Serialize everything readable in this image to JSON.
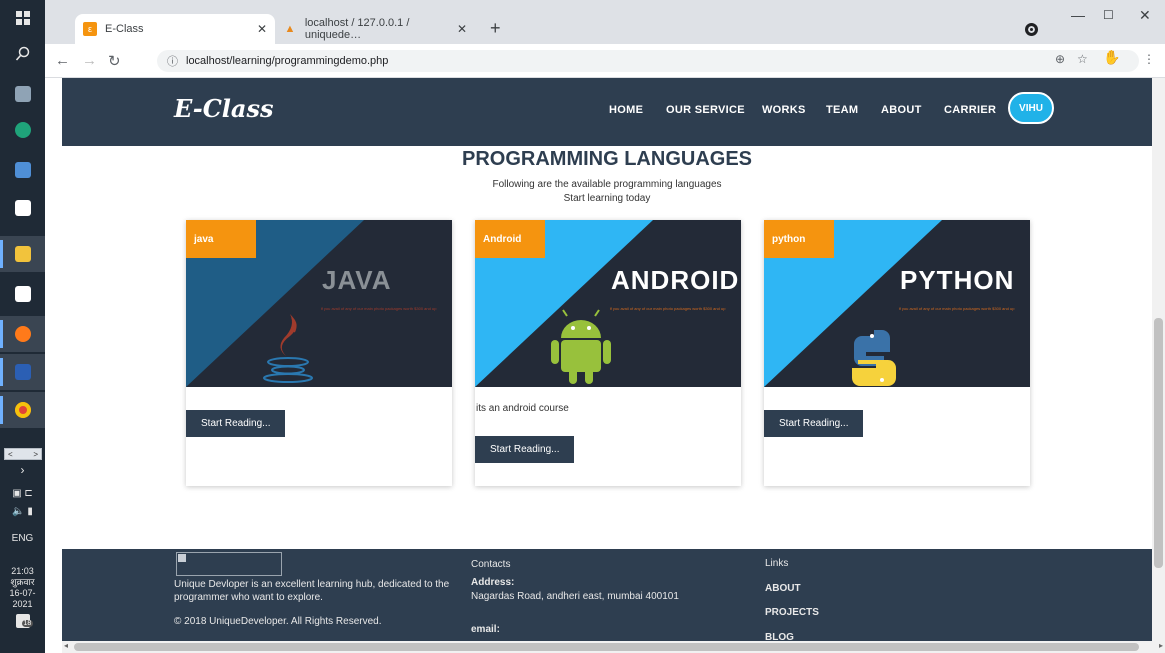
{
  "browser": {
    "tabs": [
      {
        "label": "E-Class",
        "favicon_color": "#f5940f",
        "favicon_char": "ε"
      },
      {
        "label": "localhost / 127.0.0.1 / uniquede…",
        "favicon_color": "#e8891d",
        "favicon_char": "⛵"
      }
    ],
    "url": "localhost/learning/programmingdemo.php"
  },
  "os": {
    "clock_time": "21:03",
    "clock_day": "शुक्रवार",
    "clock_date": "16-07-2021",
    "language": "ENG",
    "notification_count": "18"
  },
  "site": {
    "logo": "E-Class",
    "nav": [
      "HOME",
      "OUR SERVICE",
      "WORKS",
      "TEAM",
      "ABOUT",
      "CARRIER"
    ],
    "user_button": "VIHU",
    "title": "PROGRAMMING LANGUAGES",
    "subtitle_line1": "Following are the available programming languages",
    "subtitle_line2": "Start learning today"
  },
  "courses": [
    {
      "badge": "java",
      "title": "JAVA",
      "tagline": "If you avail of any of our main photo packages worth $300 and up",
      "description": "",
      "button": "Start Reading...",
      "colors": {
        "light": "#1f5d86",
        "dark": "#232a37",
        "title": "#8a9096",
        "tagline": "#a03b2c"
      }
    },
    {
      "badge": "Android",
      "title": "ANDROID",
      "tagline": "If you avail of any of our main photo packages worth $300 and up",
      "description": "its an android course",
      "button": "Start Reading...",
      "colors": {
        "light": "#2fb6f4",
        "dark": "#232a37",
        "title": "#ffffff",
        "tagline": "#d2691e"
      }
    },
    {
      "badge": "python",
      "title": "PYTHON",
      "tagline": "If you avail of any of our main photo packages worth $300 and up",
      "description": "",
      "button": "Start Reading...",
      "colors": {
        "light": "#2fb6f4",
        "dark": "#232a37",
        "title": "#ffffff",
        "tagline": "#d2691e"
      }
    }
  ],
  "footer": {
    "about": "Unique Devloper is an excellent learning hub, dedicated to the programmer who want to explore.",
    "copyright": "© 2018 UniqueDeveloper. All Rights Reserved.",
    "contacts_heading": "Contacts",
    "address_label": "Address:",
    "address": "Nagardas Road, andheri east, mumbai 400101",
    "email_label": "email:",
    "links_heading": "Links",
    "links": [
      "ABOUT",
      "PROJECTS",
      "BLOG"
    ]
  },
  "icons": [
    "windows-icon",
    "search-icon",
    "camera-icon",
    "edge-icon",
    "network-icon",
    "mail-icon",
    "folder-icon",
    "store-icon",
    "firefox-icon",
    "word-icon",
    "chrome-icon"
  ]
}
